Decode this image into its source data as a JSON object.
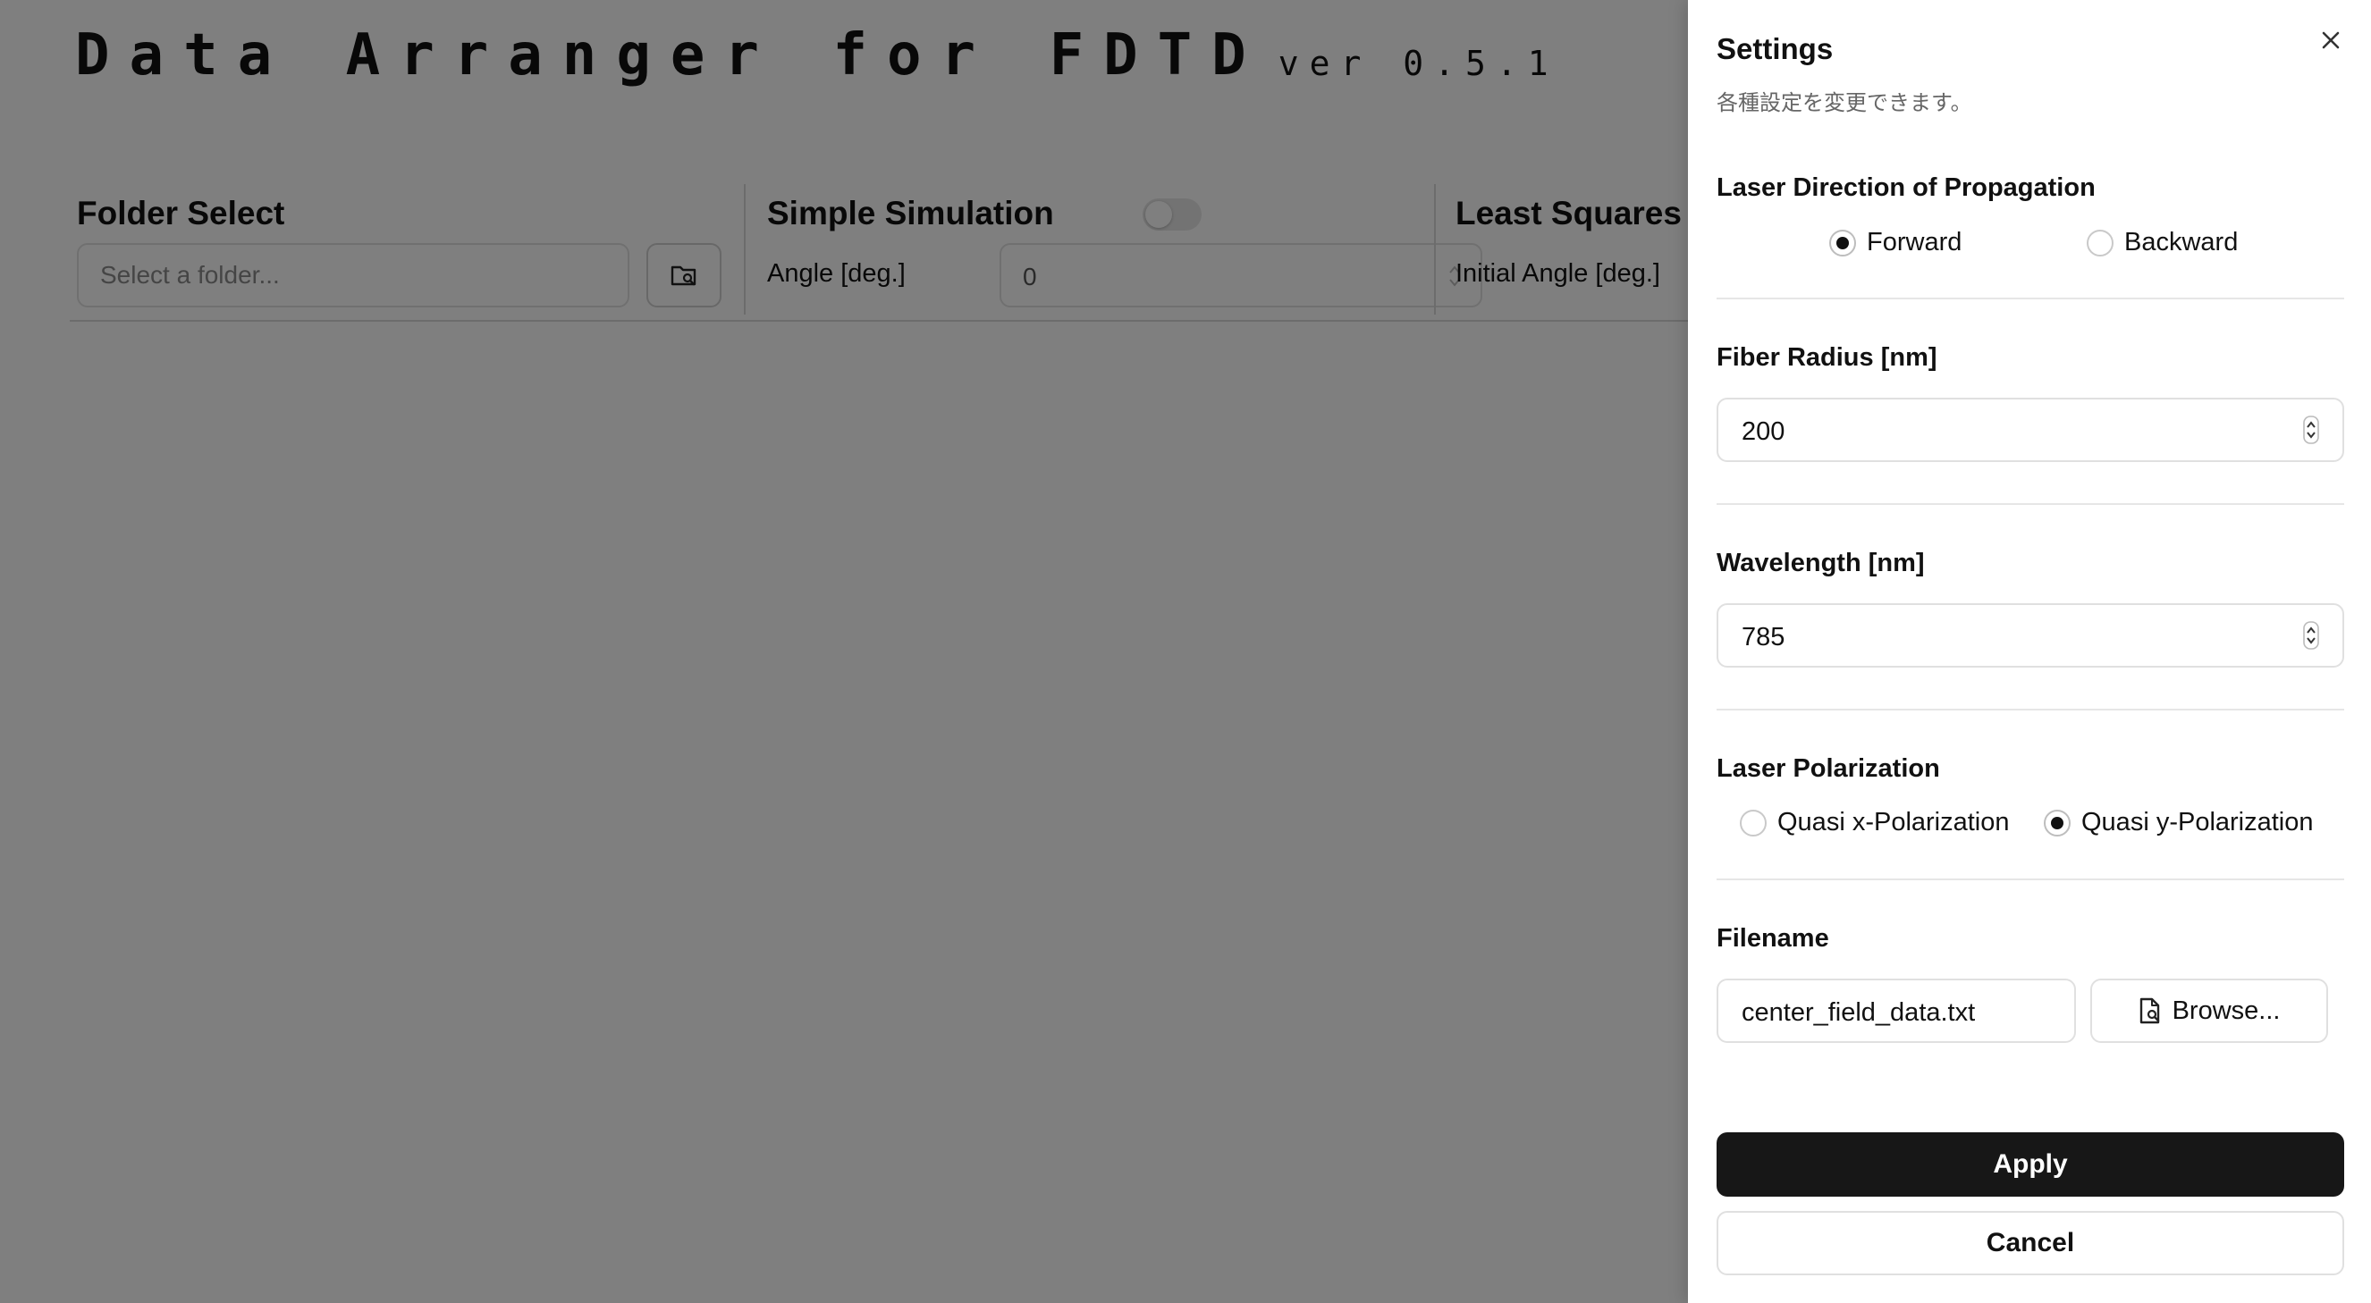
{
  "app": {
    "title": "Data Arranger for FDTD",
    "version": "ver 0.5.1"
  },
  "toolbar": {
    "folder_select": {
      "heading": "Folder Select",
      "placeholder": "Select a folder...",
      "browse_icon": "folder-search-icon"
    },
    "simple_simulation": {
      "heading": "Simple Simulation",
      "toggle_on": false,
      "angle_label": "Angle [deg.]",
      "angle_value": "0"
    },
    "least_squares": {
      "heading": "Least Squares",
      "initial_angle_label": "Initial Angle [deg.]"
    }
  },
  "settings": {
    "title": "Settings",
    "description": "各種設定を変更できます。",
    "close_icon": "close-icon",
    "laser_direction": {
      "label": "Laser Direction of Propagation",
      "options": [
        {
          "label": "Forward",
          "checked": true
        },
        {
          "label": "Backward",
          "checked": false
        }
      ]
    },
    "fiber_radius": {
      "label": "Fiber Radius [nm]",
      "value": "200"
    },
    "wavelength": {
      "label": "Wavelength [nm]",
      "value": "785"
    },
    "laser_polarization": {
      "label": "Laser Polarization",
      "options": [
        {
          "label": "Quasi x-Polarization",
          "checked": false
        },
        {
          "label": "Quasi y-Polarization",
          "checked": true
        }
      ]
    },
    "filename": {
      "label": "Filename",
      "value": "center_field_data.txt",
      "browse_label": "Browse...",
      "browse_icon": "file-search-icon"
    },
    "apply_label": "Apply",
    "cancel_label": "Cancel"
  }
}
